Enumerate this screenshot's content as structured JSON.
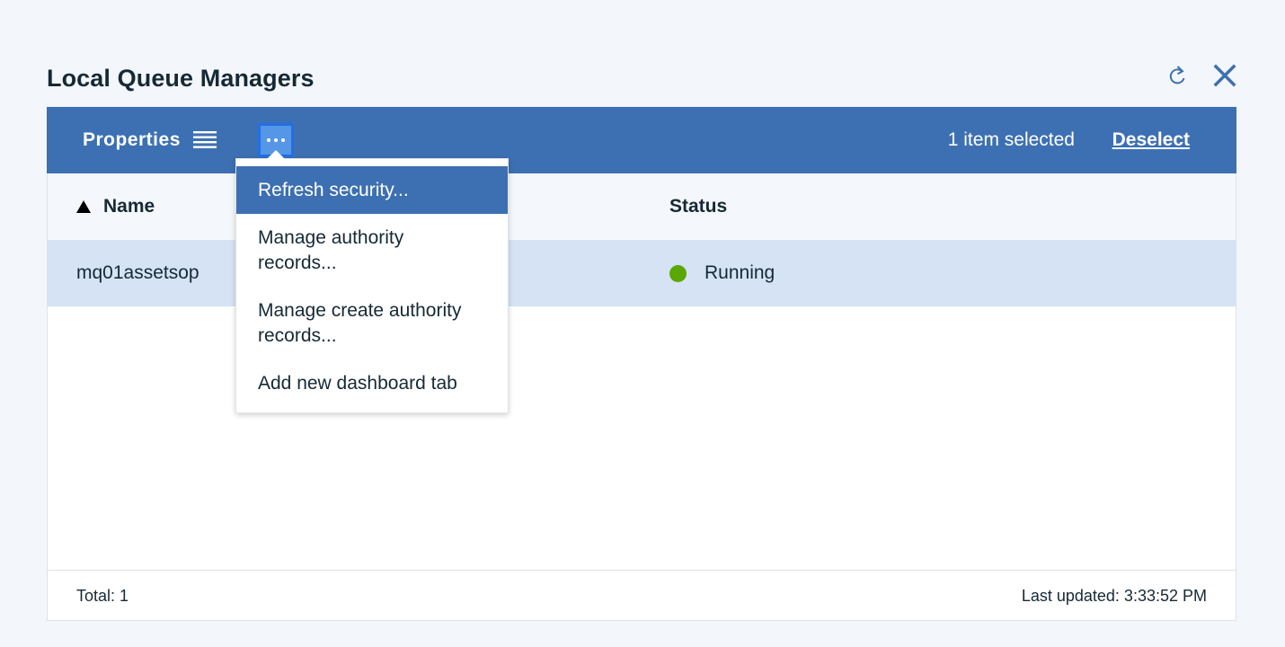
{
  "widget": {
    "title": "Local Queue Managers"
  },
  "top_icons": {
    "refresh": "refresh-icon",
    "close": "close-icon"
  },
  "toolbar": {
    "properties_label": "Properties",
    "properties_icon": "list-icon",
    "more_icon": "overflow-menu-icon",
    "selected_text": "1 item selected",
    "deselect_label": "Deselect"
  },
  "table": {
    "columns": [
      {
        "label": "Name",
        "sort": "ascending"
      },
      {
        "label": "Status"
      }
    ],
    "rows": [
      {
        "name": "mq01assetsop",
        "status": "Running",
        "status_color": "#5aa700",
        "selected": true
      }
    ]
  },
  "footer": {
    "total": "Total: 1",
    "last_updated": "Last updated: 3:33:52 PM"
  },
  "overflow_menu": {
    "items": [
      {
        "label": "Refresh security...",
        "highlighted": true
      },
      {
        "label": "Manage authority records..."
      },
      {
        "label": "Manage create authority records..."
      },
      {
        "label": "Add new dashboard tab"
      }
    ]
  },
  "colors": {
    "accent": "#3d70b2",
    "selected_row": "#d5e3f4",
    "running": "#5aa700",
    "page_bg": "#f3f6fa"
  }
}
